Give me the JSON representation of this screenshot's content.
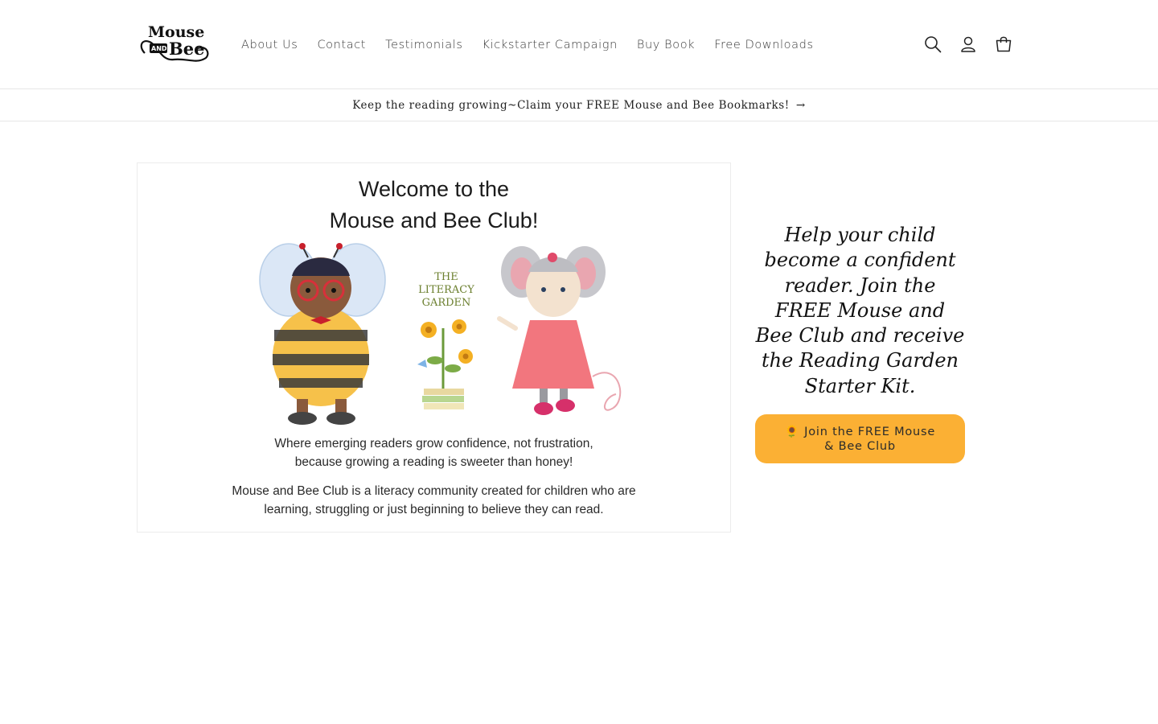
{
  "header": {
    "logo": {
      "line1": "Mouse",
      "line2": "AND",
      "line3": "Bee"
    },
    "nav": [
      {
        "label": "About Us"
      },
      {
        "label": "Contact"
      },
      {
        "label": "Testimonials"
      },
      {
        "label": "Kickstarter Campaign"
      },
      {
        "label": "Buy Book"
      },
      {
        "label": "Free Downloads"
      }
    ],
    "icons": [
      "search-icon",
      "account-icon",
      "cart-icon"
    ]
  },
  "announcement": {
    "text": "Keep the reading growing~Claim your FREE Mouse and Bee Bookmarks!",
    "arrow": "→"
  },
  "hero": {
    "image": {
      "title_line1": "Welcome to the",
      "title_line2": "Mouse and Bee Club!",
      "garden_label_1": "THE",
      "garden_label_2": "LITERACY",
      "garden_label_3": "GARDEN",
      "tagline_line1": "Where emerging readers grow confidence, not frustration,",
      "tagline_line2": "because growing a reading is sweeter than honey!",
      "desc_line1": "Mouse and Bee Club is a literacy community created for children who are",
      "desc_line2": "learning, struggling or just beginning to believe they can read."
    },
    "heading": "Help your child become a confident reader. Join the FREE Mouse and Bee Club and receive the Reading Garden Starter Kit.",
    "button_label": "🌻 Join the FREE Mouse & Bee Club"
  },
  "colors": {
    "accent": "#fbb034",
    "border": "#e6e6e6",
    "text": "#121212"
  }
}
